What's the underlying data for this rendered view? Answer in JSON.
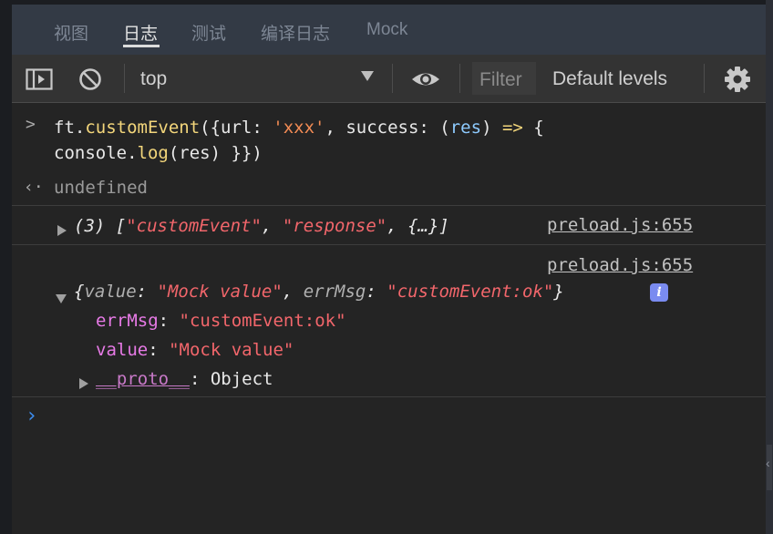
{
  "tabs": [
    "视图",
    "日志",
    "测试",
    "编译日志",
    "Mock"
  ],
  "toolbar": {
    "context": "top",
    "filter_placeholder": "Filter",
    "levels": "Default levels"
  },
  "console": {
    "input_line1": {
      "p1": "ft.",
      "fn": "customEvent",
      "p2": "({url: ",
      "str": "'xxx'",
      "p3": ", success: (",
      "var": "res",
      "p4": ") ",
      "arrow": "=>",
      "p5": " {"
    },
    "input_line2": {
      "p1": "console.",
      "fn": "log",
      "p2": "(res) }})"
    },
    "result": "undefined",
    "log1": {
      "count": "(3) [",
      "s1": "\"customEvent\"",
      "c1": ", ",
      "s2": "\"response\"",
      "c2": ", {…}]",
      "source": "preload.js:655"
    },
    "log2": {
      "source": "preload.js:655",
      "summary": {
        "k1": "value",
        "v1": "\"Mock value\"",
        "k2": "errMsg",
        "v2": "\"customEvent:ok\"",
        "open": "{",
        "close": "}"
      },
      "props": [
        {
          "key": "errMsg",
          "value": "\"customEvent:ok\""
        },
        {
          "key": "value",
          "value": "\"Mock value\""
        }
      ],
      "proto_key": "__proto__",
      "proto_value": "Object"
    }
  },
  "colors": {
    "accent_prompt": "#3d8ef0",
    "info_badge": "#7a8bf0"
  }
}
